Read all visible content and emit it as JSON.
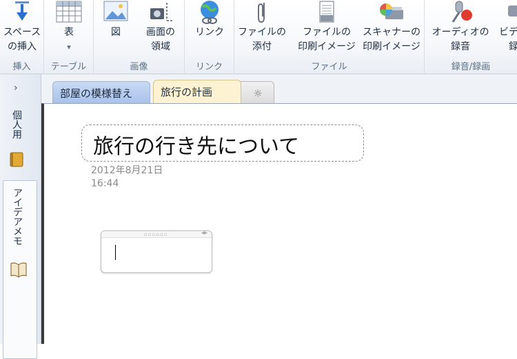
{
  "ribbon": {
    "groups": [
      {
        "label": "挿入",
        "buttons": [
          {
            "label": "スペース\nの挿入",
            "icon": "space-insert-icon"
          }
        ]
      },
      {
        "label": "テーブル",
        "buttons": [
          {
            "label": "表",
            "icon": "table-icon",
            "dropdown": "▾"
          }
        ]
      },
      {
        "label": "画像",
        "buttons": [
          {
            "label": "図",
            "icon": "picture-icon"
          },
          {
            "label": "画面の\n領域",
            "icon": "screen-clip-icon"
          }
        ]
      },
      {
        "label": "リンク",
        "buttons": [
          {
            "label": "リンク",
            "icon": "link-icon"
          }
        ]
      },
      {
        "label": "ファイル",
        "buttons": [
          {
            "label": "ファイルの\n添付",
            "icon": "attach-file-icon"
          },
          {
            "label": "ファイルの\n印刷イメージ",
            "icon": "file-printout-icon"
          },
          {
            "label": "スキャナーの\n印刷イメージ",
            "icon": "scanner-icon"
          }
        ]
      },
      {
        "label": "録音/録画",
        "buttons": [
          {
            "label": "オーディオの\n録音",
            "icon": "audio-record-icon"
          },
          {
            "label": "ビデオの\n録画",
            "icon": "video-record-icon"
          }
        ]
      }
    ]
  },
  "nav": {
    "expand_glyph": "›",
    "notebooks": [
      {
        "label": "個人用",
        "icon": "notebook-icon"
      },
      {
        "label": "アイデアメモ",
        "icon": "open-book-icon"
      }
    ]
  },
  "tabs": [
    {
      "label": "部屋の模様替え",
      "active": false
    },
    {
      "label": "旅行の計画",
      "active": true
    },
    {
      "label": "☼",
      "active": false
    }
  ],
  "page": {
    "title": "旅行の行き先について",
    "date": "2012年8月21日",
    "time": "16:44",
    "note_grip": "▫▫▫▫▫▫",
    "note_resize": "◂▸"
  }
}
